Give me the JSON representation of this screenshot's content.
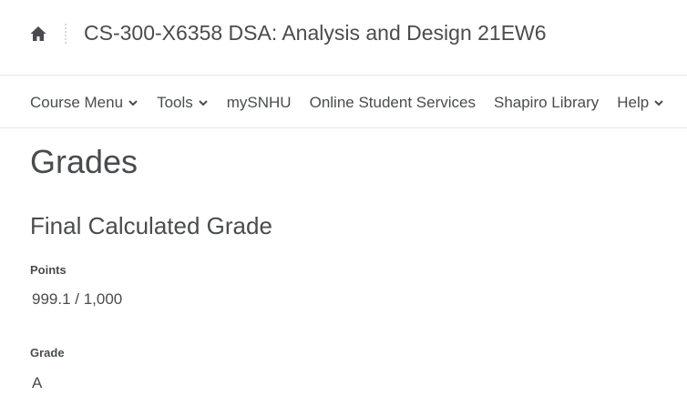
{
  "header": {
    "home_icon": "home-icon",
    "course_title": "CS-300-X6358 DSA: Analysis and Design 21EW6"
  },
  "nav": {
    "items": [
      {
        "label": "Course Menu",
        "has_dropdown": true
      },
      {
        "label": "Tools",
        "has_dropdown": true
      },
      {
        "label": "mySNHU",
        "has_dropdown": false
      },
      {
        "label": "Online Student Services",
        "has_dropdown": false
      },
      {
        "label": "Shapiro Library",
        "has_dropdown": false
      },
      {
        "label": "Help",
        "has_dropdown": true
      }
    ]
  },
  "main": {
    "page_title": "Grades",
    "section_title": "Final Calculated Grade",
    "points_label": "Points",
    "points_value": "999.1 / 1,000",
    "grade_label": "Grade",
    "grade_value": "A"
  },
  "colors": {
    "text": "#494c4e",
    "divider": "#e3e9f1",
    "background": "#ffffff"
  }
}
